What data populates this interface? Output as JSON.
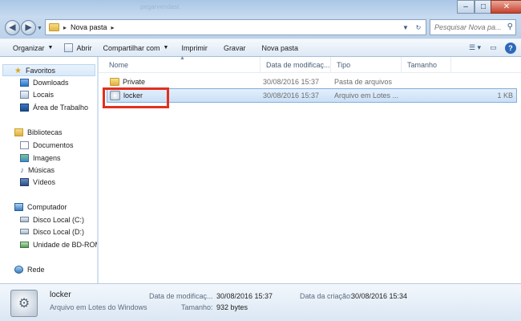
{
  "window": {
    "title_ghost": "pegarvendast"
  },
  "address": {
    "crumb": "Nova pasta",
    "search_placeholder": "Pesquisar Nova pa..."
  },
  "toolbar": {
    "organize": "Organizar",
    "open": "Abrir",
    "share": "Compartilhar com",
    "print": "Imprimir",
    "burn": "Gravar",
    "new_folder": "Nova pasta"
  },
  "nav": {
    "favorites": "Favoritos",
    "downloads": "Downloads",
    "locais": "Locais",
    "desktop": "Área de Trabalho",
    "libraries": "Bibliotecas",
    "documents": "Documentos",
    "images": "Imagens",
    "music": "Músicas",
    "videos": "Vídeos",
    "computer": "Computador",
    "disk_c": "Disco Local (C:)",
    "disk_d": "Disco Local (D:)",
    "bd_rom": "Unidade de BD-ROM",
    "network": "Rede"
  },
  "columns": {
    "name": "Nome",
    "modified": "Data de modificaç...",
    "type": "Tipo",
    "size": "Tamanho"
  },
  "files": [
    {
      "name": "Private",
      "modified": "30/08/2016 15:37",
      "type": "Pasta de arquivos",
      "size": ""
    },
    {
      "name": "locker",
      "modified": "30/08/2016 15:37",
      "type": "Arquivo em Lotes ...",
      "size": "1 KB"
    }
  ],
  "details": {
    "name": "locker",
    "type": "Arquivo em Lotes do Windows",
    "modified_label": "Data de modificaç...",
    "modified_value": "30/08/2016 15:37",
    "size_label": "Tamanho:",
    "size_value": "932 bytes",
    "created_label": "Data da criação:",
    "created_value": "30/08/2016 15:34"
  }
}
